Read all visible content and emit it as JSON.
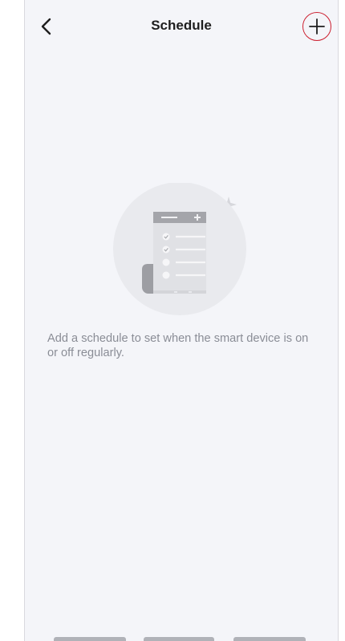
{
  "header": {
    "title": "Schedule",
    "back_icon": "chevron-left-icon",
    "add_icon": "plus-icon"
  },
  "empty_state": {
    "illustration": "schedule-list-illustration",
    "message": "Add a schedule to set when the smart device is on or off regularly."
  },
  "colors": {
    "background": "#f4f5f9",
    "title": "#1e1e1e",
    "message": "#8a8d96",
    "add_button_outline": "#cc1f2f"
  }
}
